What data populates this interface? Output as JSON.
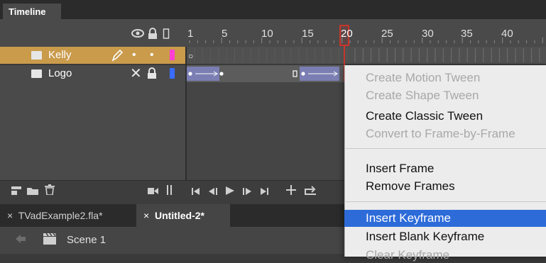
{
  "panel": {
    "title": "Timeline"
  },
  "header": {
    "frame_numbers": [
      "1",
      "5",
      "10",
      "15",
      "20",
      "25",
      "30",
      "35",
      "40"
    ],
    "current_frame": "20",
    "icons": [
      "eye-icon",
      "lock-icon",
      "outline-icon"
    ]
  },
  "layers": [
    {
      "name": "Kelly",
      "color": "#ff3fd2",
      "selected": true,
      "visible": "•",
      "locked": "•"
    },
    {
      "name": "Logo",
      "color": "#3a6cff",
      "selected": false,
      "visible": "✕",
      "locked": "locked"
    }
  ],
  "context_menu": {
    "items": [
      {
        "label": "Create Motion Tween",
        "enabled": false
      },
      {
        "label": "Create Shape Tween",
        "enabled": false
      },
      {
        "label": "Create Classic Tween",
        "enabled": true
      },
      {
        "label": "Convert to Frame-by-Frame",
        "enabled": false
      },
      {
        "label": "Insert Frame",
        "enabled": true
      },
      {
        "label": "Remove Frames",
        "enabled": true
      },
      {
        "label": "Insert Keyframe",
        "enabled": true,
        "highlighted": true
      },
      {
        "label": "Insert Blank Keyframe",
        "enabled": true
      },
      {
        "label": "Clear Keyframe",
        "enabled": false
      }
    ]
  },
  "doc_tabs": [
    {
      "label": "TVadExample2.fla*",
      "close": "×"
    },
    {
      "label": "Untitled-2*",
      "close": "×"
    }
  ],
  "scene": {
    "name": "Scene 1"
  },
  "colors": {
    "accent": "#2d6bd9",
    "playhead": "#c8362d",
    "selected_layer": "#c99b4b",
    "tween": "#7a7eb2"
  }
}
